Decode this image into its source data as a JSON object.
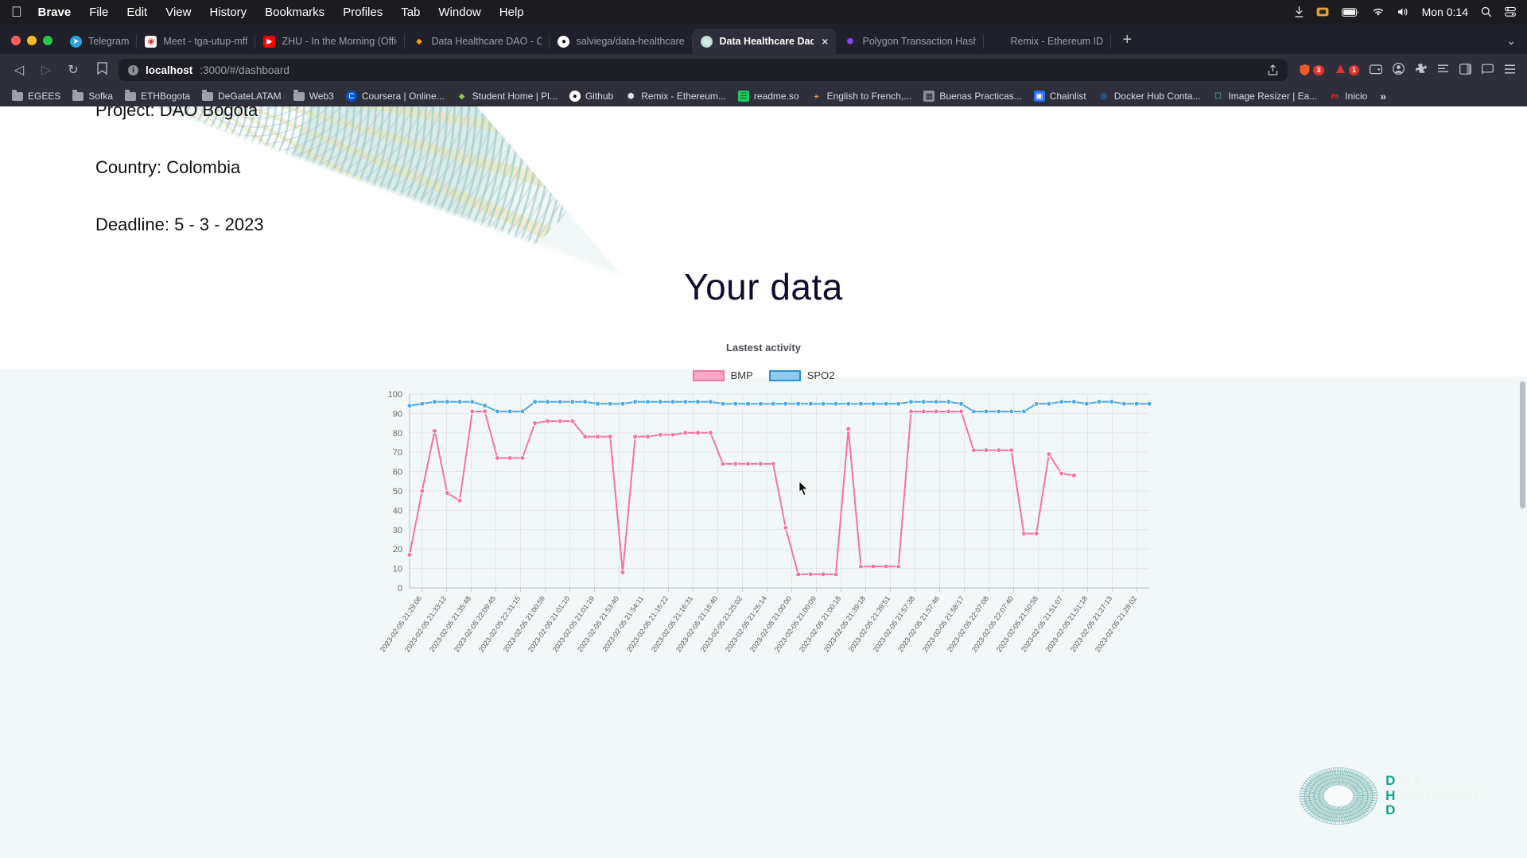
{
  "macos": {
    "apple": "apple-logo",
    "menus": [
      "Brave",
      "File",
      "Edit",
      "View",
      "History",
      "Bookmarks",
      "Profiles",
      "Tab",
      "Window",
      "Help"
    ],
    "clock": "Mon 0:14",
    "status_icons": [
      "download-icon",
      "screen-record-icon",
      "battery-icon",
      "wifi-icon",
      "volume-icon"
    ]
  },
  "browser": {
    "tabs": [
      {
        "label": "Telegram",
        "favicon": "telegram-icon",
        "active": false
      },
      {
        "label": "Meet - tga-utup-mff",
        "favicon": "google-meet-icon",
        "active": false
      },
      {
        "label": "ZHU - In the Morning (Official V",
        "favicon": "youtube-icon",
        "active": false
      },
      {
        "label": "Data Healthcare DAO - Cloud Fi",
        "favicon": "firebase-icon",
        "active": false
      },
      {
        "label": "salviega/data-healthcare-dao-fr",
        "favicon": "github-icon",
        "active": false
      },
      {
        "label": "Data Healthcare Dao",
        "favicon": "dhd-icon",
        "active": true
      },
      {
        "label": "Polygon Transaction Hash (Txha",
        "favicon": "polygon-icon",
        "active": false
      },
      {
        "label": "Remix - Ethereum IDE",
        "favicon": "remix-icon",
        "active": false
      }
    ],
    "tab_close_label": "×",
    "new_tab_label": "+",
    "tabstrip_overflow": "⌄",
    "nav": {
      "back": "◁",
      "forward": "▷",
      "reload": "↻",
      "bookmark_star": "☐"
    },
    "omnibox": {
      "lock": "i",
      "host": "localhost",
      "path": ":3000/#/dashboard"
    },
    "toolbar_icons": [
      "share-icon",
      "brave-shields-icon",
      "brave-rewards-icon",
      "wallet-icon",
      "extensions-icon",
      "reading-list-icon",
      "sidebar-icon",
      "cast-icon",
      "menu-icon"
    ],
    "shield_count": "3",
    "rewards_count": "1",
    "bookmarks": [
      {
        "label": "EGEES",
        "icon": "folder-icon"
      },
      {
        "label": "Sofka",
        "icon": "folder-icon"
      },
      {
        "label": "ETHBogota",
        "icon": "folder-icon"
      },
      {
        "label": "DeGateLATAM",
        "icon": "folder-icon"
      },
      {
        "label": "Web3",
        "icon": "folder-icon"
      },
      {
        "label": "Coursera | Online...",
        "icon": "coursera-icon"
      },
      {
        "label": "Student Home | Pl...",
        "icon": "platzi-icon"
      },
      {
        "label": "Github",
        "icon": "github-icon"
      },
      {
        "label": "Remix - Ethereum...",
        "icon": "remix-icon"
      },
      {
        "label": "readme.so",
        "icon": "readme-icon"
      },
      {
        "label": "English to French,...",
        "icon": "translate-icon"
      },
      {
        "label": "Buenas Practicas...",
        "icon": "doc-icon"
      },
      {
        "label": "Chainlist",
        "icon": "chainlist-icon"
      },
      {
        "label": "Docker Hub Conta...",
        "icon": "docker-icon"
      },
      {
        "label": "Image Resizer | Ea...",
        "icon": "resizer-icon"
      },
      {
        "label": "Inicio",
        "icon": "inicio-icon"
      }
    ],
    "bookmarks_overflow": "»"
  },
  "page": {
    "project_line": "Project: DAO Bogota",
    "country_line": "Country: Colombia",
    "deadline_line": "Deadline: 5 - 3 - 2023",
    "title": "Your data",
    "brand": {
      "line1_key": "D",
      "line1_rest": "ATA",
      "line2_key": "H",
      "line2_rest": "EALTHCARE",
      "line3_key": "D",
      "line3_rest": "",
      "key_color": "#18a08c"
    }
  },
  "chart_data": {
    "type": "line",
    "title": "Lastest activity",
    "xlabel": "",
    "ylabel": "",
    "ylim": [
      0,
      100
    ],
    "yticks": [
      0,
      10,
      20,
      30,
      40,
      50,
      60,
      70,
      80,
      90,
      100
    ],
    "grid": true,
    "legend_position": "top",
    "colors": {
      "BMP": "#f472a4",
      "SPO2": "#49a9e8"
    },
    "categories": [
      "2023-02-05 21:29:06",
      "2023-02-05 21:33:12",
      "2023-02-05 21:35:48",
      "2023-02-05 22:09:45",
      "2023-02-05 22:31:15",
      "2023-02-05 21:00:59",
      "2023-02-05 21:01:10",
      "2023-02-05 21:01:19",
      "2023-02-05 21:53:40",
      "2023-02-05 21:54:11",
      "2023-02-05 21:16:22",
      "2023-02-05 21:16:31",
      "2023-02-05 21:16:40",
      "2023-02-05 21:25:02",
      "2023-02-05 21:25:14",
      "2023-02-05 21:00:00",
      "2023-02-05 21:00:09",
      "2023-02-05 21:00:18",
      "2023-02-05 21:39:18",
      "2023-02-05 21:39:51",
      "2023-02-05 21:57:38",
      "2023-02-05 21:57:46",
      "2023-02-05 21:58:17",
      "2023-02-05 22:07:08",
      "2023-02-05 22:07:40",
      "2023-02-05 21:50:58",
      "2023-02-05 21:51:07",
      "2023-02-05 21:51:18",
      "2023-02-05 21:27:13",
      "2023-02-05 21:28:02"
    ],
    "series": [
      {
        "name": "BMP",
        "color": "#f472a4",
        "values": [
          17,
          50,
          81,
          49,
          45,
          91,
          91,
          67,
          67,
          67,
          85,
          86,
          86,
          86,
          78,
          78,
          78,
          8,
          78,
          78,
          79,
          79,
          80,
          80,
          80,
          64,
          64,
          64,
          64,
          64,
          31,
          7,
          7,
          7,
          7,
          82,
          11,
          11,
          11,
          11,
          91,
          91,
          91,
          91,
          91,
          71,
          71,
          71,
          71,
          28,
          28,
          69,
          59,
          58
        ]
      },
      {
        "name": "SPO2",
        "color": "#49a9e8",
        "values": [
          94,
          95,
          96,
          96,
          96,
          96,
          94,
          91,
          91,
          91,
          96,
          96,
          96,
          96,
          96,
          95,
          95,
          95,
          96,
          96,
          96,
          96,
          96,
          96,
          96,
          95,
          95,
          95,
          95,
          95,
          95,
          95,
          95,
          95,
          95,
          95,
          95,
          95,
          95,
          95,
          96,
          96,
          96,
          96,
          95,
          91,
          91,
          91,
          91,
          91,
          95,
          95,
          96,
          96,
          95,
          96,
          96,
          95,
          95,
          95
        ]
      }
    ]
  }
}
